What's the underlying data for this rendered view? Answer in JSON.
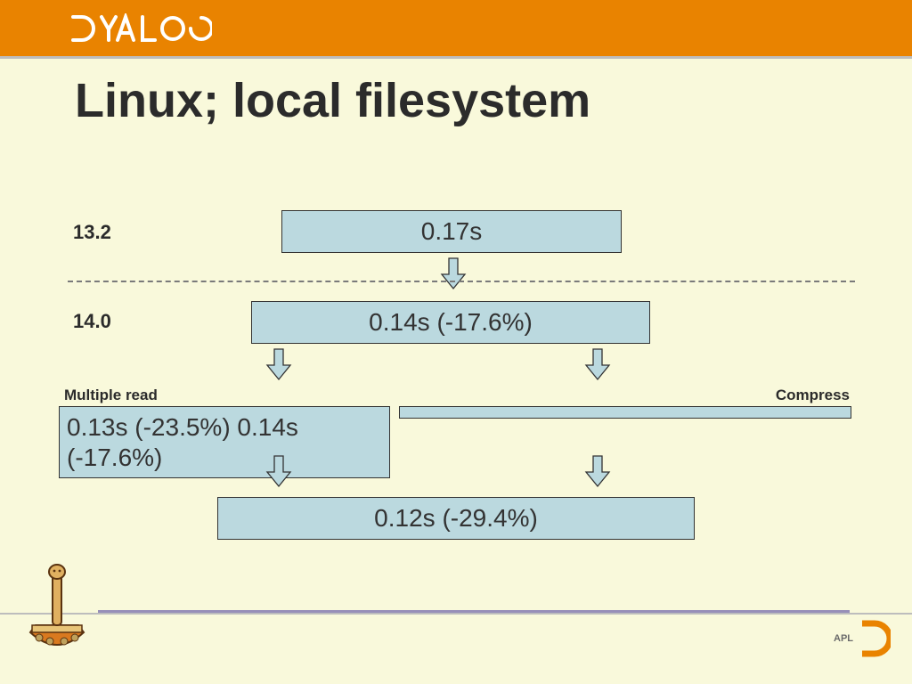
{
  "header": {
    "brand": "DYALOG"
  },
  "title": "Linux; local filesystem",
  "labels": {
    "v132": "13.2",
    "v140": "14.0",
    "multiread": "Multiple read",
    "compress": "Compress"
  },
  "boxes": {
    "a": "0.17s",
    "b": "0.14s (-17.6%)",
    "c": "0.13s (-23.5%)     0.14s (-17.6%)",
    "d": "",
    "e": "0.12s (-29.4%)"
  },
  "footer": {
    "apl": "APL"
  },
  "chart_data": {
    "type": "table",
    "title": "Linux; local filesystem",
    "versions": [
      {
        "name": "13.2",
        "baseline_seconds": 0.17
      },
      {
        "name": "14.0",
        "baseline_seconds": 0.14,
        "baseline_pct_change": -17.6,
        "multiple_read_seconds": 0.13,
        "multiple_read_pct_change": -23.5,
        "compress_seconds": 0.14,
        "compress_pct_change": -17.6,
        "combined_seconds": 0.12,
        "combined_pct_change": -29.4
      }
    ]
  }
}
